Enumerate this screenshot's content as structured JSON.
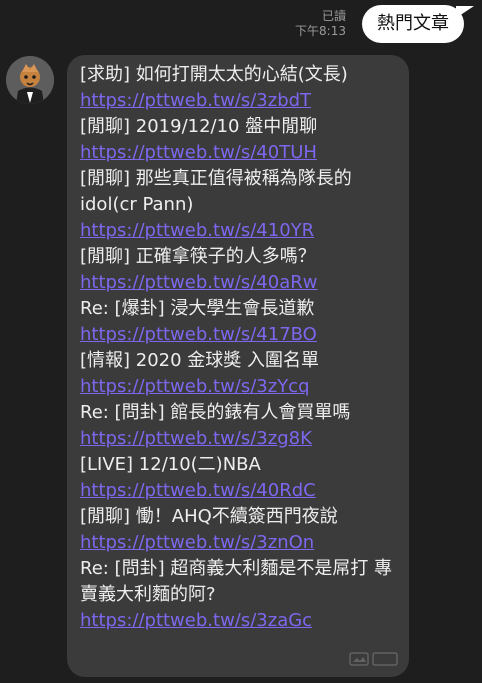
{
  "outgoing": {
    "status_read": "已讀",
    "time": "下午8:13",
    "text": "熱門文章"
  },
  "incoming": {
    "lines": [
      {
        "text": "[求助] 如何打開太太的心結(文長)",
        "link": "https://pttweb.tw/s/3zbdT"
      },
      {
        "text": "[閒聊] 2019/12/10 盤中閒聊",
        "link": "https://pttweb.tw/s/40TUH"
      },
      {
        "text": "[閒聊] 那些真正值得被稱為隊長的 idol(cr Pann)",
        "link": "https://pttweb.tw/s/410YR"
      },
      {
        "text": "[閒聊] 正確拿筷子的人多嗎？",
        "link": "https://pttweb.tw/s/40aRw"
      },
      {
        "text": "Re: [爆卦] 浸大學生會長道歉",
        "link": "https://pttweb.tw/s/417BO"
      },
      {
        "text": "[情報] 2020 金球獎 入圍名單",
        "link": "https://pttweb.tw/s/3zYcq"
      },
      {
        "text": "Re: [問卦] 館長的錶有人會買單嗎",
        "link": "https://pttweb.tw/s/3zg8K"
      },
      {
        "text": "[LIVE] 12/10(二)NBA",
        "link": "https://pttweb.tw/s/40RdC"
      },
      {
        "text": "[閒聊] 慟！AHQ不續簽西門夜說",
        "link": "https://pttweb.tw/s/3znOn"
      },
      {
        "text": "Re: [問卦] 超商義大利麵是不是屌打 專賣義大利麵的阿?",
        "link": "https://pttweb.tw/s/3zaGc"
      }
    ]
  },
  "colors": {
    "background": "#1e1e1e",
    "incoming_bubble": "#3b3b3b",
    "outgoing_bubble": "#ffffff",
    "link": "#7b68ee",
    "text": "#eeeeee",
    "meta": "#9b9b9b"
  },
  "icons": [
    "avatar",
    "gallery-watermark-icon"
  ]
}
